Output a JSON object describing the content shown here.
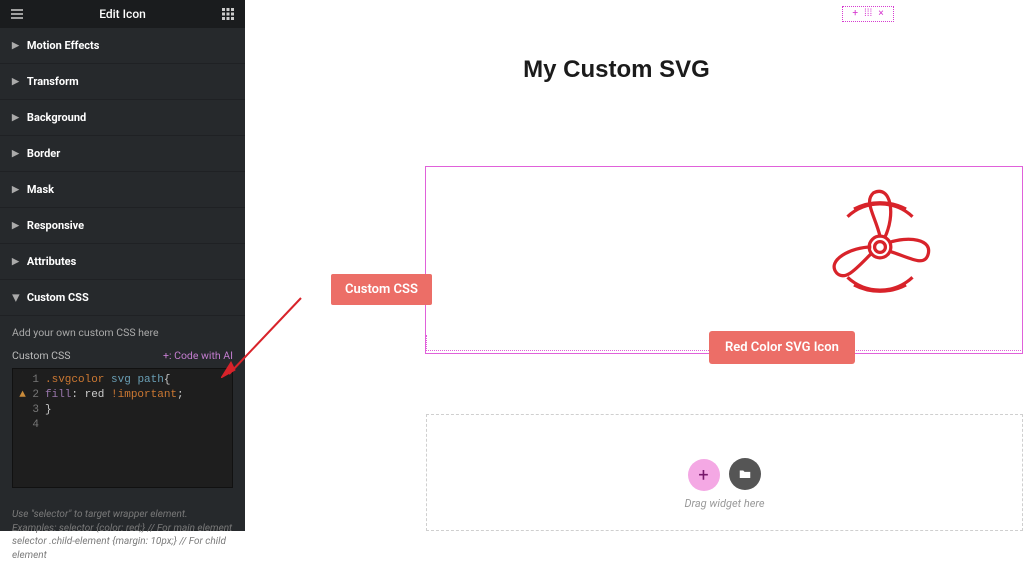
{
  "sidebar": {
    "title": "Edit Icon",
    "items": [
      {
        "label": "Motion Effects"
      },
      {
        "label": "Transform"
      },
      {
        "label": "Background"
      },
      {
        "label": "Border"
      },
      {
        "label": "Mask"
      },
      {
        "label": "Responsive"
      },
      {
        "label": "Attributes"
      },
      {
        "label": "Custom CSS"
      }
    ],
    "css_desc": "Add your own custom CSS here",
    "css_label": "Custom CSS",
    "code_ai": "+: Code with AI",
    "code": {
      "l1": ".svgcolor svg path{",
      "l2": "fill: red !important;",
      "l3": "}",
      "l4": ""
    },
    "help": "Use \"selector\" to target wrapper element. Examples: selector {color: red;} // For main element selector .child-element {margin: 10px;} // For child element"
  },
  "canvas": {
    "heading": "My Custom SVG",
    "callout": "Custom CSS",
    "red_button": "Red Color SVG Icon",
    "drag_text": "Drag widget here"
  },
  "colors": {
    "accent_pink": "#e061da",
    "danger_red": "#d8232a",
    "button_red": "#ec6e67"
  }
}
